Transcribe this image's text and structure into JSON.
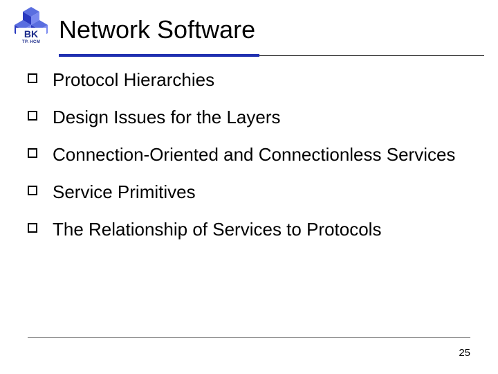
{
  "logo": {
    "main": "BK",
    "sub": "TP. HCM"
  },
  "title": "Network Software",
  "items": [
    "Protocol Hierarchies",
    "Design Issues for the Layers",
    "Connection-Oriented and Connectionless Services",
    "Service Primitives",
    "The Relationship of Services to Protocols"
  ],
  "page_number": "25"
}
